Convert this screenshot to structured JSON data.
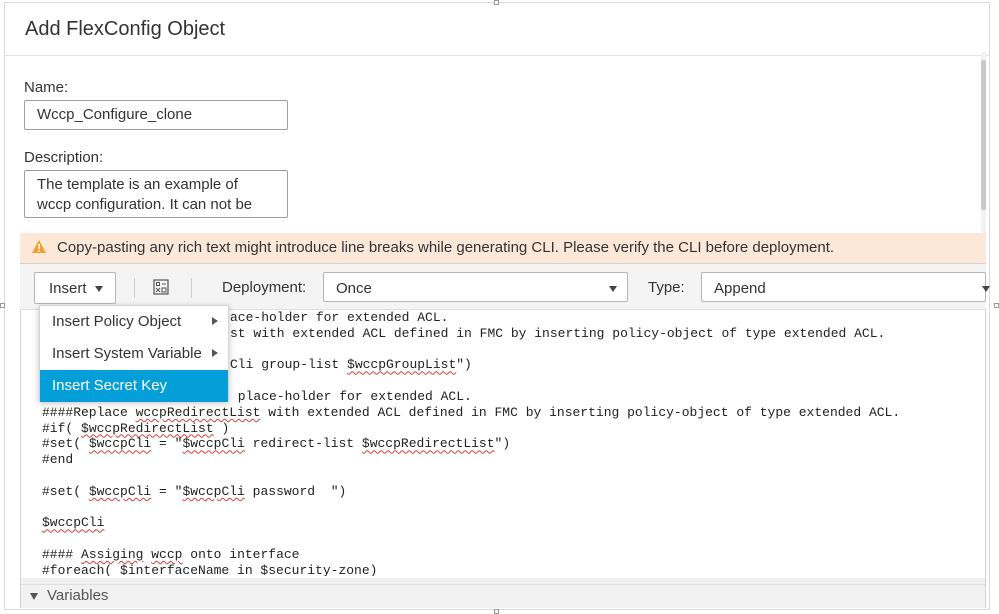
{
  "dialog": {
    "title": "Add FlexConfig Object"
  },
  "form": {
    "name_label": "Name:",
    "name_value": "Wccp_Configure_clone",
    "description_label": "Description:",
    "description_lines": [
      "The template is an example of",
      "wccp configuration. It can not be"
    ]
  },
  "warning": {
    "text": "Copy-pasting any rich text might introduce line breaks while generating CLI. Please verify the CLI before deployment.",
    "color": "#fce8d8",
    "icon_color": "#f0a030"
  },
  "toolbar": {
    "insert_label": "Insert",
    "deployment_label": "Deployment:",
    "deployment_value": "Once",
    "type_label": "Type:",
    "type_value": "Append"
  },
  "insert_menu": {
    "items": [
      {
        "label": "Insert Policy Object",
        "has_submenu": true
      },
      {
        "label": "Insert System Variable",
        "has_submenu": true
      },
      {
        "label": "Insert Secret Key",
        "has_submenu": false,
        "selected": true
      }
    ],
    "highlight_color": "#049fd9"
  },
  "code_lines": [
    {
      "text": "ace-holder for extended ACL.",
      "x_indent": "menu"
    },
    {
      "text": "st with extended ACL defined in FMC by inserting policy-object of type extended ACL.",
      "x_indent": "menu"
    },
    {
      "text": "",
      "x_indent": ""
    },
    {
      "text": "Cli group-list $wccpGroupList\")",
      "x_indent": "menu"
    },
    {
      "text": "",
      "x_indent": ""
    },
    {
      "text": " place-holder for extended ACL.",
      "x_indent": "menu"
    },
    {
      "text": "####Replace wccpRedirectList with extended ACL defined in FMC by inserting policy-object of type extended ACL.",
      "x_indent": ""
    },
    {
      "text": "#if( $wccpRedirectList )",
      "x_indent": ""
    },
    {
      "text": "#set( $wccpCli = \"$wccpCli redirect-list $wccpRedirectList\")",
      "x_indent": ""
    },
    {
      "text": "#end",
      "x_indent": ""
    },
    {
      "text": "",
      "x_indent": ""
    },
    {
      "text": "#set( $wccpCli = \"$wccpCli password  \")",
      "x_indent": ""
    },
    {
      "text": "",
      "x_indent": ""
    },
    {
      "text": "$wccpCli",
      "x_indent": ""
    },
    {
      "text": "",
      "x_indent": ""
    },
    {
      "text": "#### Assiging wccp onto interface",
      "x_indent": ""
    },
    {
      "text": "#foreach( $interfaceName in $security-zone)",
      "x_indent": ""
    }
  ],
  "variables_section": {
    "label": "Variables"
  }
}
